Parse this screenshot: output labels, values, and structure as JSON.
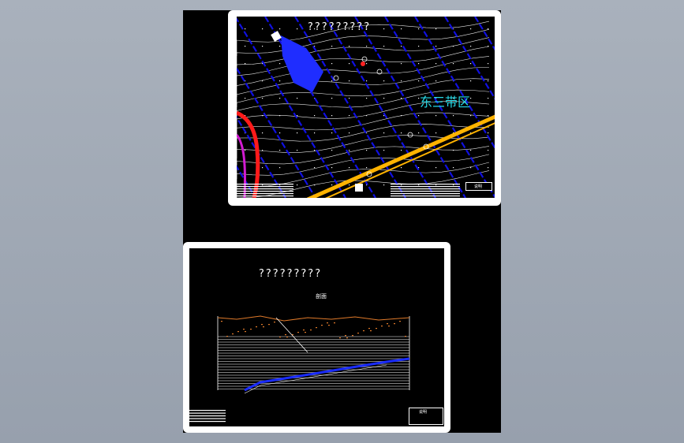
{
  "colors": {
    "background": "#a1a9b5",
    "model_space": "#000000",
    "sheet_border": "#ffffff",
    "grid_blue": "#1010e0",
    "contour": "#ffffff",
    "highway": "#ffb300",
    "river": "#ff1a1a",
    "zone_text": "#26d9e6",
    "terrain": "#e07a2a",
    "profile_line": "#1a2cff"
  },
  "sheet_plan": {
    "title": "?????????",
    "zone_label": "东三带区",
    "title_block_label": "说明"
  },
  "sheet_section": {
    "title": "?????????",
    "section_label": "剖面",
    "title_block_label": "说明"
  },
  "icons": {
    "plan": "map-plan-icon",
    "section": "geologic-section-icon"
  }
}
